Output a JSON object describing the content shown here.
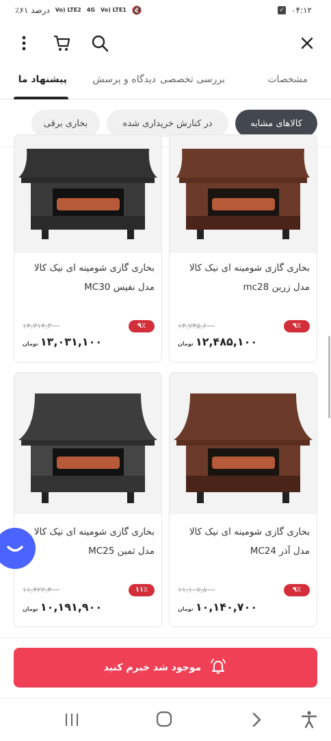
{
  "status_bar": {
    "time": "۰۴:۱۲",
    "battery": "٪۶۱ درصد",
    "lte1": "Vo) LTE1",
    "lte2": "Vo) LTE2",
    "net": "4G"
  },
  "tabs": [
    {
      "label": "مشخصات"
    },
    {
      "label": "بررسی تخصصی"
    },
    {
      "label": "دیدگاه و پرسش"
    },
    {
      "label": "پیشنهاد ما"
    }
  ],
  "chips": [
    {
      "label": "کالاهای مشابه"
    },
    {
      "label": "در کنارش خریداری شده"
    },
    {
      "label": "بخاری برقی"
    }
  ],
  "products": [
    {
      "title": "بخاری گازی شومینه ای نیک کالا مدل زرین mc28",
      "old_price": "۱۳,۷۴۵,۶۰۰",
      "discount": "۹٪",
      "price": "۱۲,۴۸۵,۱۰۰",
      "currency": "تومان",
      "color": "#6b3a28"
    },
    {
      "title": "بخاری گازی شومینه ای نیک کالا مدل نفیس MC30",
      "old_price": "۱۴,۳۱۴,۳۰۰",
      "discount": "۹٪",
      "price": "۱۳,۰۳۱,۱۰۰",
      "currency": "تومان",
      "color": "#333333"
    },
    {
      "title": "بخاری گازی شومینه ای نیک کالا مدل آذر MC24",
      "old_price": "۱۱,۱۰۷,۸۰۰",
      "discount": "۹٪",
      "price": "۱۰,۱۴۰,۷۰۰",
      "currency": "تومان",
      "color": "#6b3a28"
    },
    {
      "title": "بخاری گازی شومینه ای نیک کالا مدل ثمین MC25",
      "old_price": "۱۱,۴۲۲,۴۰۰",
      "discount": "۱۱٪",
      "price": "۱۰,۱۹۱,۹۰۰",
      "currency": "تومان",
      "color": "#3d3d3d"
    }
  ],
  "notify_button": {
    "label": "موجود شد خبرم کنید"
  },
  "colors": {
    "accent": "#ef4056",
    "badge": "#d32f3a",
    "chip_active": "#424750",
    "fab": "#4b63ff"
  }
}
